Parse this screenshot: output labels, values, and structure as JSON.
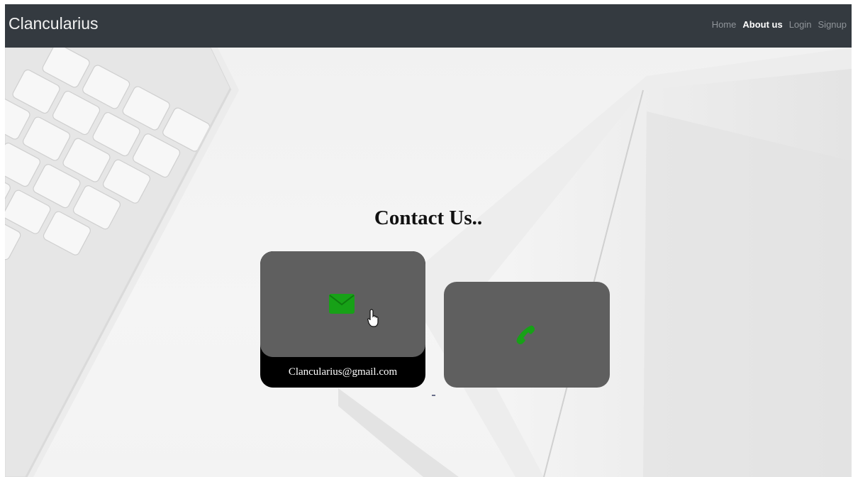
{
  "navbar": {
    "brand": "Clancularius",
    "links": [
      {
        "label": "Home",
        "active": false
      },
      {
        "label": "About us",
        "active": true
      },
      {
        "label": "Login",
        "active": false
      },
      {
        "label": "Signup",
        "active": false
      }
    ]
  },
  "main": {
    "title": "Contact Us..",
    "cards": [
      {
        "id": "email",
        "icon": "envelope-icon",
        "caption": "Clancularius@gmail.com"
      },
      {
        "id": "phone",
        "icon": "phone-icon",
        "caption": ""
      }
    ]
  },
  "colors": {
    "navbar_bg": "#343a40",
    "card_bg": "#5f5f5f",
    "icon_green": "#17a117"
  }
}
